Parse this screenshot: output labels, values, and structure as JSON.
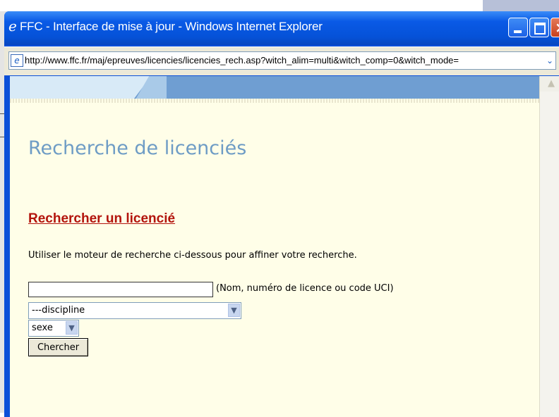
{
  "window": {
    "title": "FFC - Interface de mise à jour - Windows Internet Explorer",
    "url": "http://www.ffc.fr/maj/epreuves/licencies/licencies_rech.asp?witch_alim=multi&witch_comp=0&witch_mode=",
    "browser_icon": "ie-icon",
    "title_icon_glyph": "e"
  },
  "page": {
    "title": "Recherche de licenciés",
    "section_title": "Rechercher un licencié",
    "intro": "Utiliser le moteur de recherche ci-dessous pour affiner votre recherche."
  },
  "form": {
    "search_value": "",
    "search_hint": "(Nom, numéro de licence ou code UCI)",
    "discipline_selected": "---discipline",
    "sexe_selected": "sexe",
    "submit_label": "Chercher"
  },
  "colors": {
    "title_blue": "#6e9cc5",
    "section_red": "#b3140c",
    "content_bg": "#fffee8",
    "titlebar_blue": "#0552d8"
  }
}
